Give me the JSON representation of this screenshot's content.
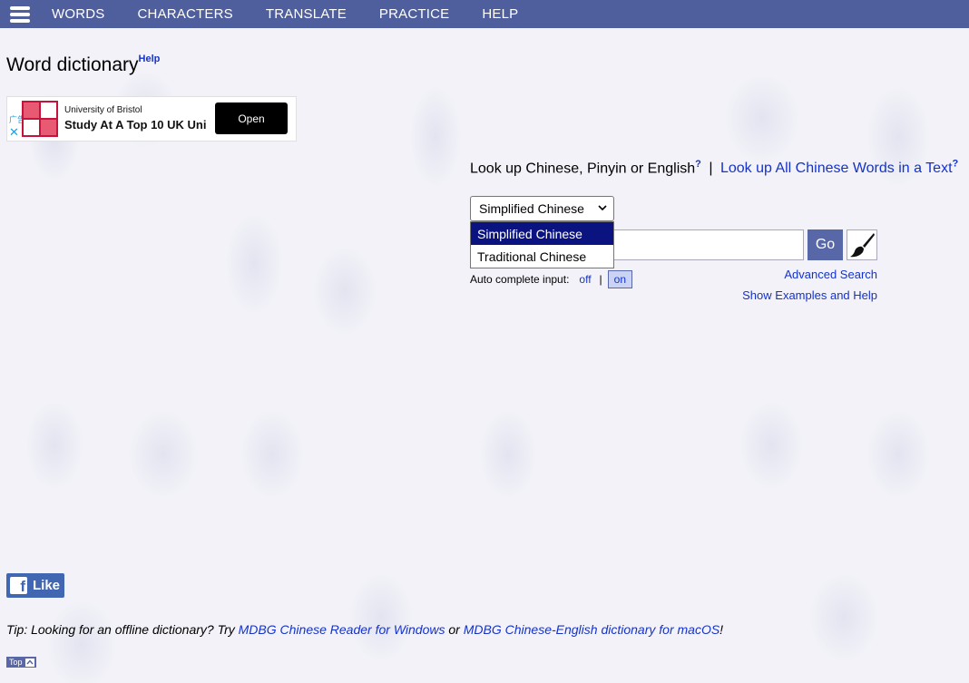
{
  "nav": {
    "items": [
      "WORDS",
      "CHARACTERS",
      "TRANSLATE",
      "PRACTICE",
      "HELP"
    ]
  },
  "page": {
    "title": "Word dictionary",
    "help_label": "Help"
  },
  "ad": {
    "label": "广告",
    "brand": "University of Bristol",
    "headline": "Study At A Top 10 UK Uni",
    "open_label": "Open"
  },
  "lookup": {
    "heading": "Look up Chinese, Pinyin or English",
    "heading_sup": "?",
    "separator": "|",
    "all_words_link": "Look up All Chinese Words in a Text",
    "all_words_sup": "?",
    "script_select": {
      "value": "Simplified Chinese",
      "options": [
        "Simplified Chinese",
        "Traditional Chinese"
      ]
    },
    "search_value": "",
    "go_label": "Go",
    "autocomplete": {
      "label": "Auto complete input:",
      "off_label": "off",
      "separator": "|",
      "on_label": "on"
    },
    "advanced_search": "Advanced Search",
    "examples_help": "Show Examples and Help"
  },
  "social": {
    "like_label": "Like"
  },
  "tip": {
    "prefix": "Tip: Looking for an offline dictionary? Try ",
    "link1": "MDBG Chinese Reader for Windows",
    "middle": " or ",
    "link2": "MDBG Chinese-English dictionary for macOS",
    "suffix": "!"
  },
  "footer": {
    "top_label": "Top"
  },
  "colors": {
    "nav_bg": "#4f5e9c",
    "link": "#1533c9",
    "selected_option": "#0a1380",
    "go_button": "#5767a8"
  }
}
